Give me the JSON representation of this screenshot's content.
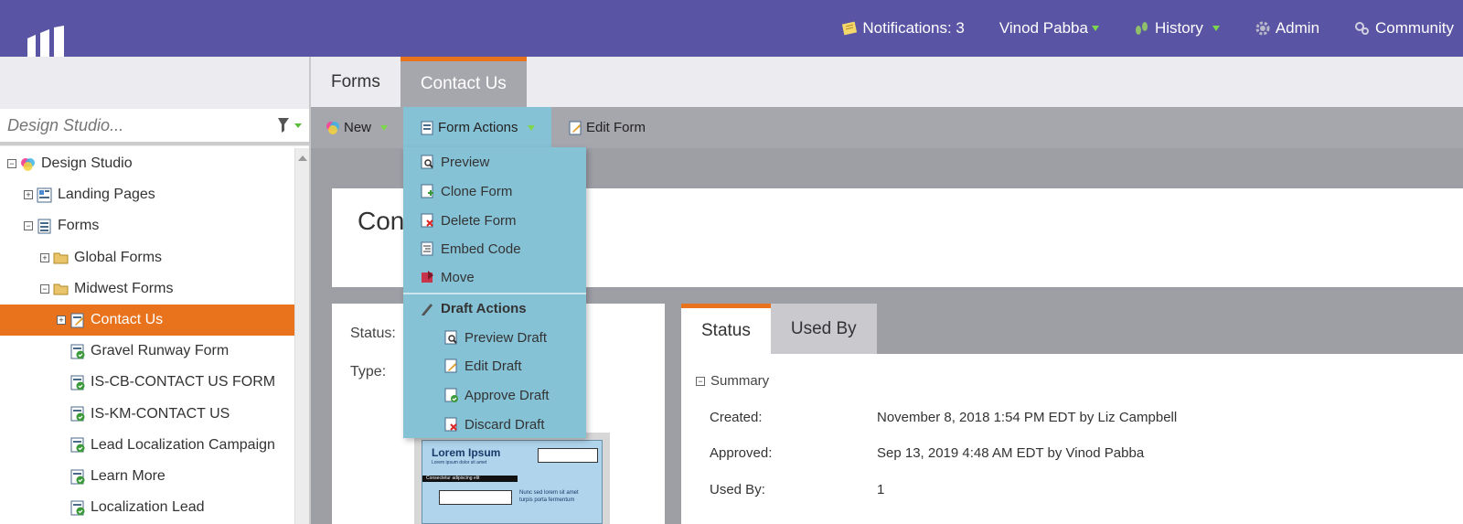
{
  "topnav": {
    "notifications": "Notifications: 3",
    "user": "Vinod Pabba",
    "history": "History",
    "admin": "Admin",
    "community": "Community"
  },
  "sidebar": {
    "search_placeholder": "Design Studio...",
    "tree": [
      {
        "label": "Design Studio",
        "expander": "−"
      },
      {
        "label": "Landing Pages",
        "expander": "+"
      },
      {
        "label": "Forms",
        "expander": "−"
      },
      {
        "label": "Global Forms",
        "expander": "+"
      },
      {
        "label": "Midwest Forms",
        "expander": "−"
      },
      {
        "label": "Contact Us",
        "expander": "+"
      },
      {
        "label": "Gravel Runway Form"
      },
      {
        "label": "IS-CB-CONTACT US FORM"
      },
      {
        "label": "IS-KM-CONTACT US"
      },
      {
        "label": "Lead Localization Campaign"
      },
      {
        "label": "Learn More"
      },
      {
        "label": "Localization Lead"
      }
    ]
  },
  "tabs": [
    "Forms",
    "Contact Us"
  ],
  "toolbar": {
    "new": "New",
    "form_actions": "Form Actions",
    "edit_form": "Edit Form"
  },
  "dropdown": {
    "items": [
      "Preview",
      "Clone Form",
      "Delete Form",
      "Embed Code",
      "Move"
    ],
    "draft_header": "Draft Actions",
    "draft_items": [
      "Preview Draft",
      "Edit Draft",
      "Approve Draft",
      "Discard Draft"
    ]
  },
  "main": {
    "title": "Con",
    "status_label": "Status:",
    "type_label": "Type:",
    "thumb": {
      "heading": "Lorem Ipsum",
      "sub": "Lorem ipsum dolor sit amet",
      "bar": "Consectetur adipiscing elit",
      "note1": "Nunc sed lorem sit amet",
      "note2": "turpis porta fermentum"
    }
  },
  "right_tabs": [
    "Status",
    "Used By"
  ],
  "summary": {
    "heading": "Summary",
    "rows": [
      {
        "label": "Created:",
        "value": "November 8, 2018 1:54 PM EDT by Liz Campbell"
      },
      {
        "label": "Approved:",
        "value": "Sep 13, 2019 4:48 AM EDT by Vinod Pabba"
      },
      {
        "label": "Used By:",
        "value": "1"
      }
    ]
  },
  "colors": {
    "header": "#5a54a4",
    "accent": "#e8731c",
    "menu": "#86c2d6",
    "toolbar": "#a6a6ad"
  }
}
